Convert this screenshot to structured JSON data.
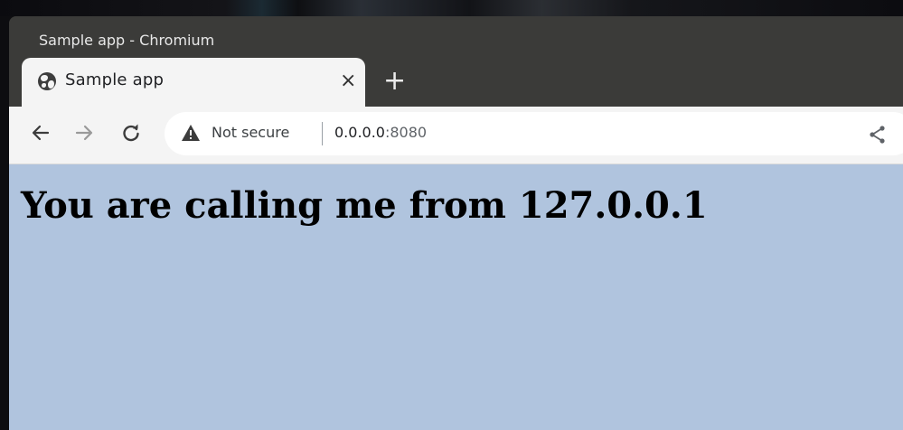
{
  "window": {
    "title": "Sample app - Chromium"
  },
  "tab": {
    "title": "Sample app",
    "favicon": "globe-icon",
    "close_glyph": "×",
    "new_tab_glyph": "+"
  },
  "toolbar": {
    "back_icon": "back-arrow-icon",
    "forward_icon": "forward-arrow-icon",
    "reload_icon": "reload-icon",
    "security_label": "Not secure",
    "url_host": "0.0.0.0",
    "url_port": ":8080",
    "share_icon": "share-icon"
  },
  "page": {
    "heading": "You are calling me from 127.0.0.1"
  },
  "colors": {
    "page_background": "#b0c4de",
    "titlebar": "#3b3b39",
    "toolbar": "#f4f4f4"
  }
}
